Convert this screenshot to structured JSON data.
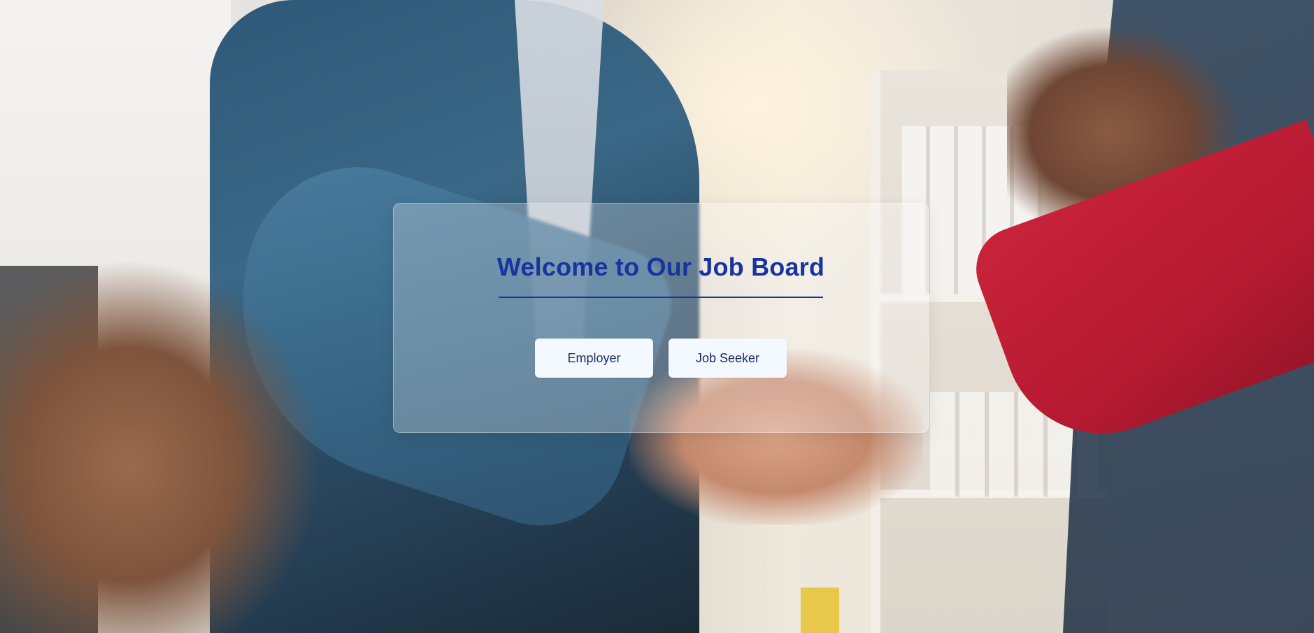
{
  "welcome": {
    "title": "Welcome to Our Job Board",
    "buttons": {
      "employer_label": "Employer",
      "job_seeker_label": "Job Seeker"
    }
  },
  "colors": {
    "title": "#1734a0",
    "button_background": "#f4f8ff",
    "button_text": "#1a2d63"
  },
  "background": {
    "image_subject": "business-handshake-photo"
  }
}
